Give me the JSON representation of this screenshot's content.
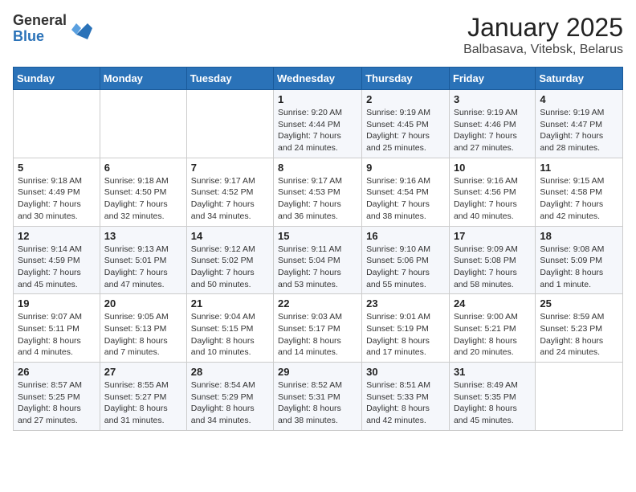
{
  "header": {
    "logo_general": "General",
    "logo_blue": "Blue",
    "title": "January 2025",
    "location": "Balbasava, Vitebsk, Belarus"
  },
  "weekdays": [
    "Sunday",
    "Monday",
    "Tuesday",
    "Wednesday",
    "Thursday",
    "Friday",
    "Saturday"
  ],
  "weeks": [
    [
      {
        "day": "",
        "info": ""
      },
      {
        "day": "",
        "info": ""
      },
      {
        "day": "",
        "info": ""
      },
      {
        "day": "1",
        "info": "Sunrise: 9:20 AM\nSunset: 4:44 PM\nDaylight: 7 hours\nand 24 minutes."
      },
      {
        "day": "2",
        "info": "Sunrise: 9:19 AM\nSunset: 4:45 PM\nDaylight: 7 hours\nand 25 minutes."
      },
      {
        "day": "3",
        "info": "Sunrise: 9:19 AM\nSunset: 4:46 PM\nDaylight: 7 hours\nand 27 minutes."
      },
      {
        "day": "4",
        "info": "Sunrise: 9:19 AM\nSunset: 4:47 PM\nDaylight: 7 hours\nand 28 minutes."
      }
    ],
    [
      {
        "day": "5",
        "info": "Sunrise: 9:18 AM\nSunset: 4:49 PM\nDaylight: 7 hours\nand 30 minutes."
      },
      {
        "day": "6",
        "info": "Sunrise: 9:18 AM\nSunset: 4:50 PM\nDaylight: 7 hours\nand 32 minutes."
      },
      {
        "day": "7",
        "info": "Sunrise: 9:17 AM\nSunset: 4:52 PM\nDaylight: 7 hours\nand 34 minutes."
      },
      {
        "day": "8",
        "info": "Sunrise: 9:17 AM\nSunset: 4:53 PM\nDaylight: 7 hours\nand 36 minutes."
      },
      {
        "day": "9",
        "info": "Sunrise: 9:16 AM\nSunset: 4:54 PM\nDaylight: 7 hours\nand 38 minutes."
      },
      {
        "day": "10",
        "info": "Sunrise: 9:16 AM\nSunset: 4:56 PM\nDaylight: 7 hours\nand 40 minutes."
      },
      {
        "day": "11",
        "info": "Sunrise: 9:15 AM\nSunset: 4:58 PM\nDaylight: 7 hours\nand 42 minutes."
      }
    ],
    [
      {
        "day": "12",
        "info": "Sunrise: 9:14 AM\nSunset: 4:59 PM\nDaylight: 7 hours\nand 45 minutes."
      },
      {
        "day": "13",
        "info": "Sunrise: 9:13 AM\nSunset: 5:01 PM\nDaylight: 7 hours\nand 47 minutes."
      },
      {
        "day": "14",
        "info": "Sunrise: 9:12 AM\nSunset: 5:02 PM\nDaylight: 7 hours\nand 50 minutes."
      },
      {
        "day": "15",
        "info": "Sunrise: 9:11 AM\nSunset: 5:04 PM\nDaylight: 7 hours\nand 53 minutes."
      },
      {
        "day": "16",
        "info": "Sunrise: 9:10 AM\nSunset: 5:06 PM\nDaylight: 7 hours\nand 55 minutes."
      },
      {
        "day": "17",
        "info": "Sunrise: 9:09 AM\nSunset: 5:08 PM\nDaylight: 7 hours\nand 58 minutes."
      },
      {
        "day": "18",
        "info": "Sunrise: 9:08 AM\nSunset: 5:09 PM\nDaylight: 8 hours\nand 1 minute."
      }
    ],
    [
      {
        "day": "19",
        "info": "Sunrise: 9:07 AM\nSunset: 5:11 PM\nDaylight: 8 hours\nand 4 minutes."
      },
      {
        "day": "20",
        "info": "Sunrise: 9:05 AM\nSunset: 5:13 PM\nDaylight: 8 hours\nand 7 minutes."
      },
      {
        "day": "21",
        "info": "Sunrise: 9:04 AM\nSunset: 5:15 PM\nDaylight: 8 hours\nand 10 minutes."
      },
      {
        "day": "22",
        "info": "Sunrise: 9:03 AM\nSunset: 5:17 PM\nDaylight: 8 hours\nand 14 minutes."
      },
      {
        "day": "23",
        "info": "Sunrise: 9:01 AM\nSunset: 5:19 PM\nDaylight: 8 hours\nand 17 minutes."
      },
      {
        "day": "24",
        "info": "Sunrise: 9:00 AM\nSunset: 5:21 PM\nDaylight: 8 hours\nand 20 minutes."
      },
      {
        "day": "25",
        "info": "Sunrise: 8:59 AM\nSunset: 5:23 PM\nDaylight: 8 hours\nand 24 minutes."
      }
    ],
    [
      {
        "day": "26",
        "info": "Sunrise: 8:57 AM\nSunset: 5:25 PM\nDaylight: 8 hours\nand 27 minutes."
      },
      {
        "day": "27",
        "info": "Sunrise: 8:55 AM\nSunset: 5:27 PM\nDaylight: 8 hours\nand 31 minutes."
      },
      {
        "day": "28",
        "info": "Sunrise: 8:54 AM\nSunset: 5:29 PM\nDaylight: 8 hours\nand 34 minutes."
      },
      {
        "day": "29",
        "info": "Sunrise: 8:52 AM\nSunset: 5:31 PM\nDaylight: 8 hours\nand 38 minutes."
      },
      {
        "day": "30",
        "info": "Sunrise: 8:51 AM\nSunset: 5:33 PM\nDaylight: 8 hours\nand 42 minutes."
      },
      {
        "day": "31",
        "info": "Sunrise: 8:49 AM\nSunset: 5:35 PM\nDaylight: 8 hours\nand 45 minutes."
      },
      {
        "day": "",
        "info": ""
      }
    ]
  ]
}
